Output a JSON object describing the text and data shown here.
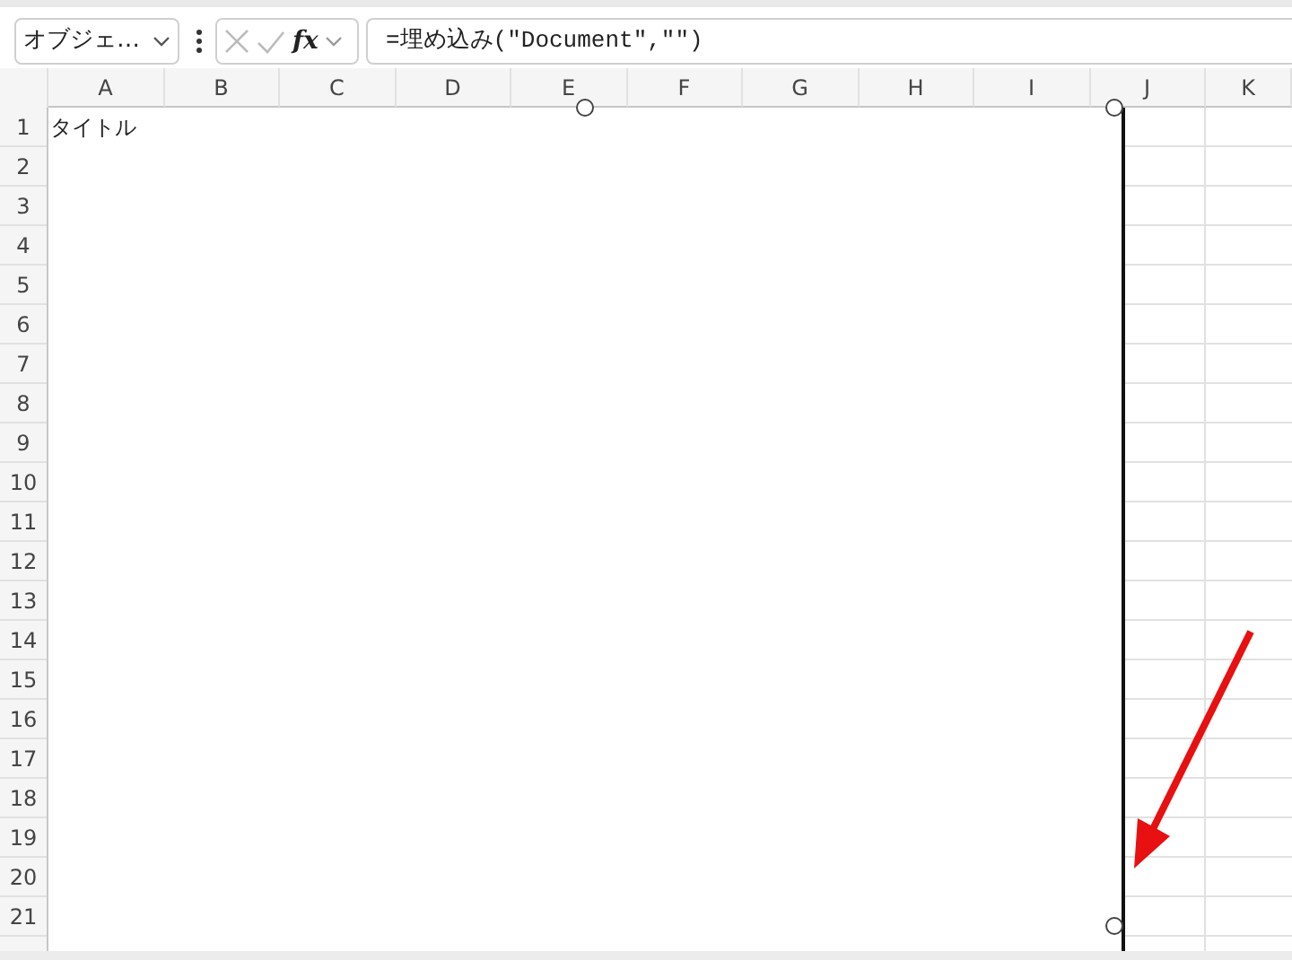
{
  "name_box": {
    "value": "オブジェ…"
  },
  "formula_bar": {
    "function_label": "fx",
    "formula": "=埋め込み(\"Document\",\"\")"
  },
  "columns": [
    "A",
    "B",
    "C",
    "D",
    "E",
    "F",
    "G",
    "H",
    "I",
    "J",
    "K"
  ],
  "rows": [
    "1",
    "2",
    "3",
    "4",
    "5",
    "6",
    "7",
    "8",
    "9",
    "10",
    "11",
    "12",
    "13",
    "14",
    "15",
    "16",
    "17",
    "18",
    "19",
    "20",
    "21"
  ],
  "embedded_object": {
    "text": "タイトル",
    "selected": true
  }
}
